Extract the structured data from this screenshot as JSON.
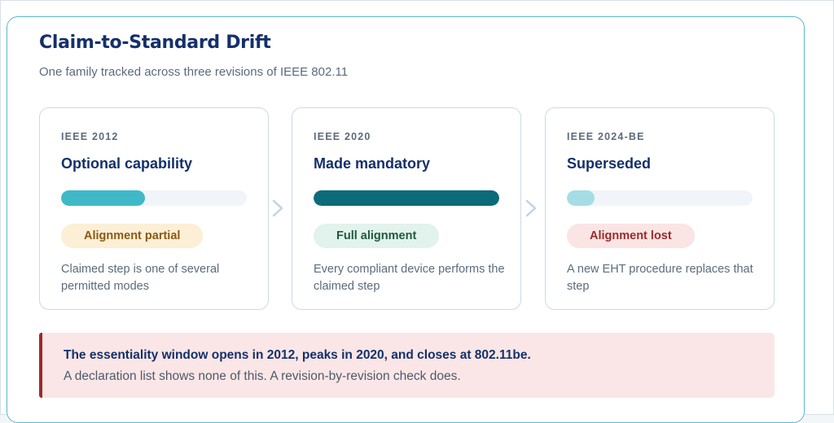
{
  "header": {
    "title": "Claim-to-Standard Drift",
    "subtitle": "One family tracked across three revisions of IEEE 802.11"
  },
  "stages": [
    {
      "eyebrow": "IEEE 2012",
      "heading": "Optional capability",
      "alignment_level": 0.45,
      "bar_color": "#3fb9c8",
      "badge": "Alignment partial",
      "badge_bg": "#fcefd6",
      "badge_fg": "#8a5a12",
      "description": "Claimed step is one of several permitted modes"
    },
    {
      "eyebrow": "IEEE 2020",
      "heading": "Made mandatory",
      "alignment_level": 1.0,
      "bar_color": "#0c6b78",
      "badge": "Full alignment",
      "badge_bg": "#e2f2ec",
      "badge_fg": "#1e5a3e",
      "description": "Every compliant device performs the claimed step"
    },
    {
      "eyebrow": "IEEE 2024-BE",
      "heading": "Superseded",
      "alignment_level": 0.15,
      "bar_color": "#a6dde4",
      "badge": "Alignment lost",
      "badge_bg": "#fbe4e4",
      "badge_fg": "#9b2b2b",
      "description": "A new EHT procedure replaces that step"
    }
  ],
  "connector_icon": "chevron-right-icon",
  "callout": {
    "lead": "The essentiality window opens in 2012, peaks in 2020, and closes at 802.11be.",
    "follow": "A declaration list shows none of this. A revision-by-revision check does."
  }
}
